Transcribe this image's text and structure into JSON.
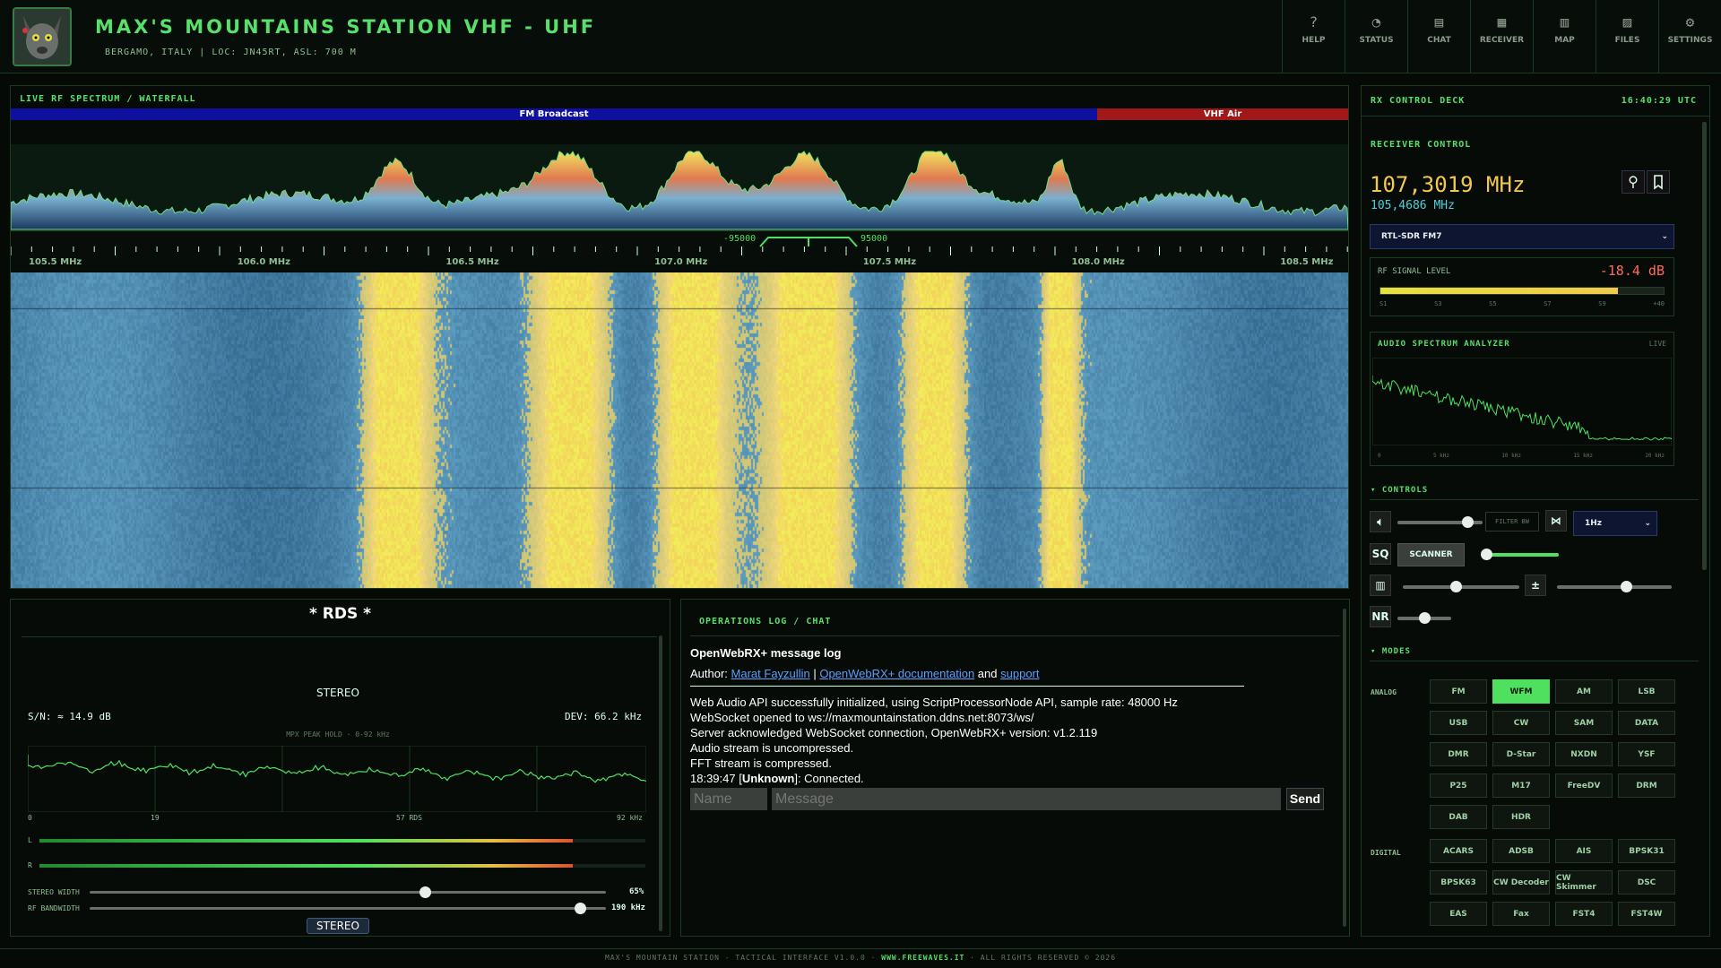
{
  "header": {
    "title": "MAX'S MOUNTAINS STATION VHF - UHF",
    "subtitle": "BERGAMO, ITALY | LOC: JN45RT, ASL: 700 M",
    "nav": [
      {
        "label": "HELP",
        "icon": "help-icon",
        "glyph": "?"
      },
      {
        "label": "STATUS",
        "icon": "gauge-icon",
        "glyph": "◔"
      },
      {
        "label": "CHAT",
        "icon": "chat-icon",
        "glyph": "▤"
      },
      {
        "label": "RECEIVER",
        "icon": "receiver-icon",
        "glyph": "▦"
      },
      {
        "label": "MAP",
        "icon": "map-icon",
        "glyph": "▥"
      },
      {
        "label": "FILES",
        "icon": "files-icon",
        "glyph": "▨"
      },
      {
        "label": "SETTINGS",
        "icon": "gear-icon",
        "glyph": "⚙"
      }
    ]
  },
  "spectrum": {
    "title": "LIVE RF SPECTRUM / WATERFALL",
    "band_fm": "FM Broadcast",
    "band_air": "VHF Air",
    "filter_low": "-95000",
    "filter_high": "95000",
    "ticks": [
      "105.5 MHz",
      "106.0 MHz",
      "106.5 MHz",
      "107.0 MHz",
      "107.5 MHz",
      "108.0 MHz",
      "108.5 MHz"
    ]
  },
  "rds": {
    "title": "* RDS *",
    "mode": "STEREO",
    "sn": "S/N: ≈ 14.9 dB",
    "dev": "DEV: 66.2 kHz",
    "mpx_label": "MPX PEAK HOLD · 0-92 kHz",
    "mpx_ticks": [
      "0",
      "19",
      "57 RDS",
      "92 kHz"
    ],
    "ch_l": "L",
    "ch_r": "R",
    "stereo_width_label": "STEREO WIDTH",
    "stereo_width_value": "65%",
    "stereo_width": 0.65,
    "rf_bw_label": "RF BANDWIDTH",
    "rf_bw_value": "190 kHz",
    "rf_bw": 0.95,
    "level_l": 0.88,
    "level_r": 0.88,
    "stereo_button": "STEREO"
  },
  "ops": {
    "title": "OPERATIONS LOG / CHAT",
    "heading": "OpenWebRX+ message log",
    "author_prefix": "Author:",
    "author": "Marat Fayzullin",
    "sep": "|",
    "doc_link": "OpenWebRX+ documentation",
    "and": "and",
    "support": "support",
    "log": [
      "Web Audio API successfully initialized, using ScriptProcessorNode API, sample rate: 48000 Hz",
      "WebSocket opened to ws://maxmountainstation.ddns.net:8073/ws/",
      "Server acknowledged WebSocket connection, OpenWebRX+ version: v1.2.119",
      "Audio stream is uncompressed.",
      "FFT stream is compressed."
    ],
    "last_time": "18:39:47 [",
    "last_user": "Unknown",
    "last_msg": "]: Connected.",
    "name_placeholder": "Name",
    "message_placeholder": "Message",
    "send": "Send"
  },
  "rx": {
    "title": "RX CONTROL DECK",
    "time": "16:40:29 UTC",
    "receiver_control": "RECEIVER CONTROL",
    "freq": "107,3019 MHz",
    "center_freq": "105,4686 MHz",
    "profile": "RTL-SDR FM7",
    "rf_label": "RF SIGNAL LEVEL",
    "rf_value": "-18.4 dB",
    "rf_level": 0.84,
    "s_scale": [
      "S1",
      "S3",
      "S5",
      "S7",
      "S9",
      "+40"
    ],
    "audio_title": "AUDIO SPECTRUM ANALYZER",
    "audio_live": "LIVE",
    "audio_ticks": [
      "0",
      "5 kHz",
      "10 kHz",
      "15 kHz",
      "20 kHz"
    ],
    "controls_title": "▾ CONTROLS",
    "filter_bw": "FILTER BW",
    "step": "1Hz",
    "sq": "SQ",
    "scanner": "SCANNER",
    "nr": "NR",
    "modes_title": "▾ MODES",
    "analog_label": "ANALOG",
    "digital_label": "DIGITAL",
    "analog": [
      "FM",
      "WFM",
      "AM",
      "LSB",
      "USB",
      "CW",
      "SAM",
      "DATA",
      "DMR",
      "D-Star",
      "NXDN",
      "YSF",
      "P25",
      "M17",
      "FreeDV",
      "DRM",
      "DAB",
      "HDR"
    ],
    "digital": [
      "ACARS",
      "ADSB",
      "AIS",
      "BPSK31",
      "BPSK63",
      "CW Decoder",
      "CW Skimmer",
      "DSC",
      "EAS",
      "Fax",
      "FST4",
      "FST4W"
    ],
    "active_mode": "WFM",
    "volume": 0.82,
    "squelch": 0.05,
    "slider3": 0.45,
    "slider4": 0.6,
    "nr_level": 0.5
  },
  "footer": {
    "left": "MAX'S MOUNTAIN STATION - TACTICAL INTERFACE V1.0.0 ·",
    "link": "WWW.FREEWAVES.IT",
    "right": "· ALL RIGHTS RESERVED © 2026"
  }
}
